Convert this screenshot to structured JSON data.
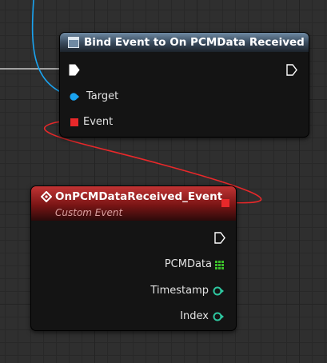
{
  "colors": {
    "canvas_bg": "#2f2f2f",
    "bind_header": "#4f6478",
    "event_header": "#a22222",
    "object_pin": "#1aa3f0",
    "delegate_pin": "#e8282a",
    "array_pin": "#3bbf2a",
    "float_pin": "#2ec7a0"
  },
  "bind_node": {
    "icon": "function-icon",
    "title": "Bind Event to On PCMData Received",
    "pins": {
      "exec_in": "exec-in-pin",
      "exec_out": "exec-out-pin",
      "target_label": "Target",
      "event_label": "Event"
    }
  },
  "event_node": {
    "icon": "event-diamond-icon",
    "title": "OnPCMDataReceived_Event",
    "subtitle": "Custom Event",
    "outputs": [
      {
        "label": "PCMData",
        "type": "array-pin"
      },
      {
        "label": "Timestamp",
        "type": "float-pin"
      },
      {
        "label": "Index",
        "type": "float-pin"
      }
    ]
  }
}
